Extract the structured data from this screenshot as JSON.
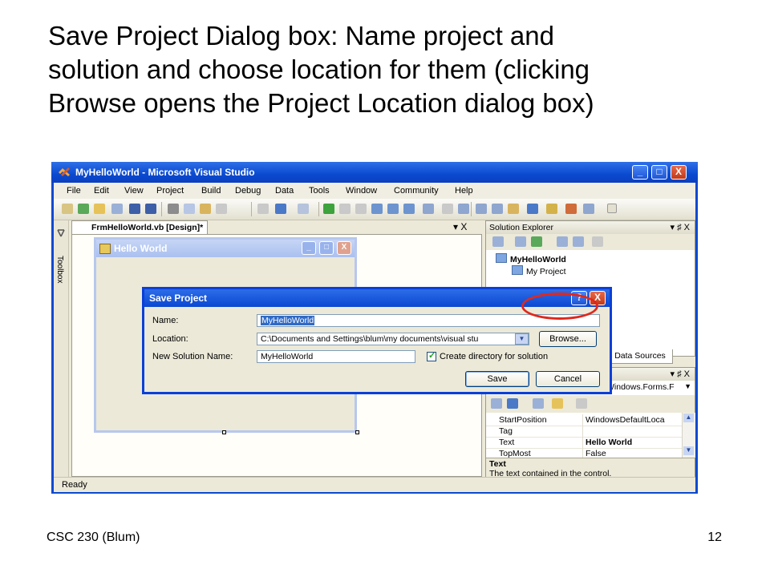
{
  "slide": {
    "title_lines": [
      "Save Project Dialog box: Name project and",
      "solution and choose location for them (clicking",
      "Browse opens the Project Location dialog box)"
    ],
    "footer_left": "CSC 230 (Blum)",
    "page_number": "12"
  },
  "vs": {
    "title": "MyHelloWorld - Microsoft Visual Studio",
    "window_buttons": {
      "minimize": "_",
      "maximize": "□",
      "close": "X"
    },
    "menu": [
      "File",
      "Edit",
      "View",
      "Project",
      "Build",
      "Debug",
      "Data",
      "Tools",
      "Window",
      "Community",
      "Help"
    ],
    "toolbox_label": "Toolbox",
    "design_tab": "FrmHelloWorld.vb [Design]*",
    "doc_controls": "▾ X",
    "status": "Ready"
  },
  "form": {
    "title": "Hello World",
    "buttons": {
      "minimize": "_",
      "maximize": "□",
      "close": "X"
    }
  },
  "solution_explorer": {
    "title": "Solution Explorer",
    "controls": "▾ ♯ X",
    "items": [
      "MyHelloWorld",
      "My Project"
    ],
    "data_sources_tab": "Data Sources"
  },
  "properties": {
    "controls": "▾ ♯ X",
    "combo_value": "Windows.Forms.F",
    "rows": [
      {
        "name": "StartPosition",
        "value": "WindowsDefaultLoca"
      },
      {
        "name": "Tag",
        "value": ""
      },
      {
        "name": "Text",
        "value": "Hello World"
      },
      {
        "name": "TopMost",
        "value": "False"
      }
    ],
    "desc_title": "Text",
    "desc_text": "The text contained in the control."
  },
  "save_dialog": {
    "title": "Save Project",
    "help_btn": "?",
    "close_btn": "X",
    "name_label": "Name:",
    "name_value": "MyHelloWorld",
    "location_label": "Location:",
    "location_value": "C:\\Documents and Settings\\blum\\my documents\\visual stu",
    "browse_label": "Browse...",
    "solution_label": "New Solution Name:",
    "solution_value": "MyHelloWorld",
    "create_dir_label": "Create directory for solution",
    "create_dir_checked": true,
    "save_label": "Save",
    "cancel_label": "Cancel"
  },
  "colors": {
    "highlight_oval": "#e0281c",
    "xp_blue": "#0a4ad0"
  }
}
